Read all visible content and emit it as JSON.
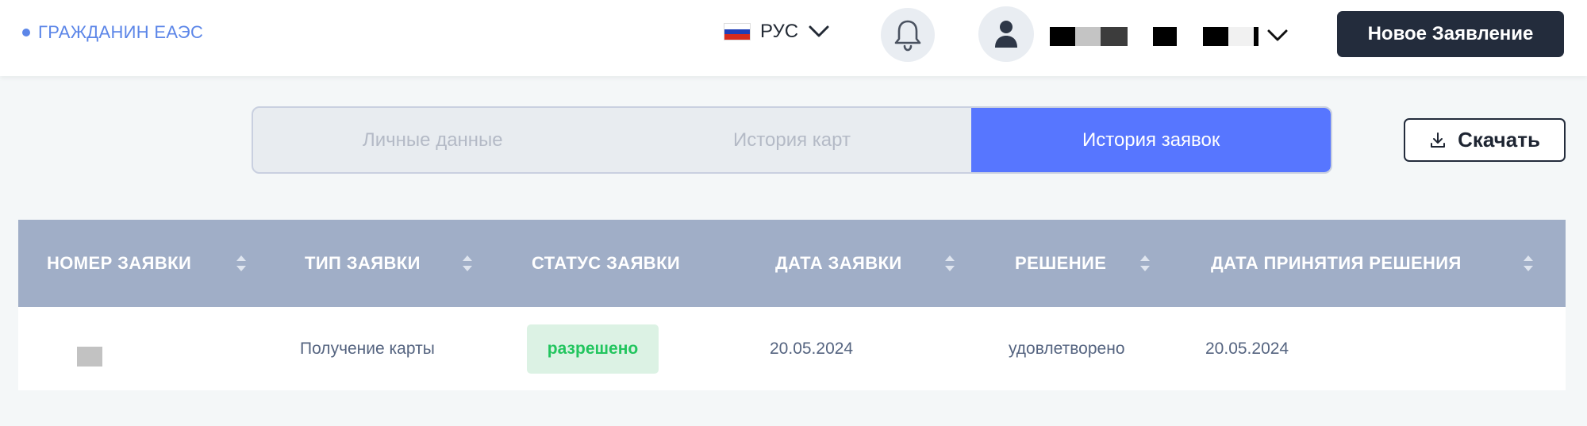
{
  "header": {
    "brand": "ГРАЖДАНИН ЕАЭС",
    "language": "РУС",
    "new_application_label": "Новое Заявление"
  },
  "tabs": [
    {
      "label": "Личные данные",
      "active": false
    },
    {
      "label": "История карт",
      "active": false
    },
    {
      "label": "История заявок",
      "active": true
    }
  ],
  "download_label": "Скачать",
  "table": {
    "columns": [
      "НОМЕР ЗАЯВКИ",
      "ТИП ЗАЯВКИ",
      "СТАТУС ЗАЯВКИ",
      "ДАТА ЗАЯВКИ",
      "РЕШЕНИЕ",
      "ДАТА ПРИНЯТИЯ РЕШЕНИЯ"
    ],
    "rows": [
      {
        "type": "Получение карты",
        "status": "разрешено",
        "date": "20.05.2024",
        "decision": "удовлетворено",
        "decision_date": "20.05.2024"
      }
    ]
  },
  "colors": {
    "accent": "#5776ff",
    "brand": "#5c86e8",
    "table_header": "#a0aec7",
    "status_ok_text": "#22c55e",
    "status_ok_bg": "#dcf2e4",
    "dark_button": "#232c3c"
  },
  "icons": {
    "language_flag": "russia-flag-icon",
    "notifications": "bell-icon",
    "user": "user-icon",
    "download": "download-icon",
    "sort": "sort-icon"
  }
}
